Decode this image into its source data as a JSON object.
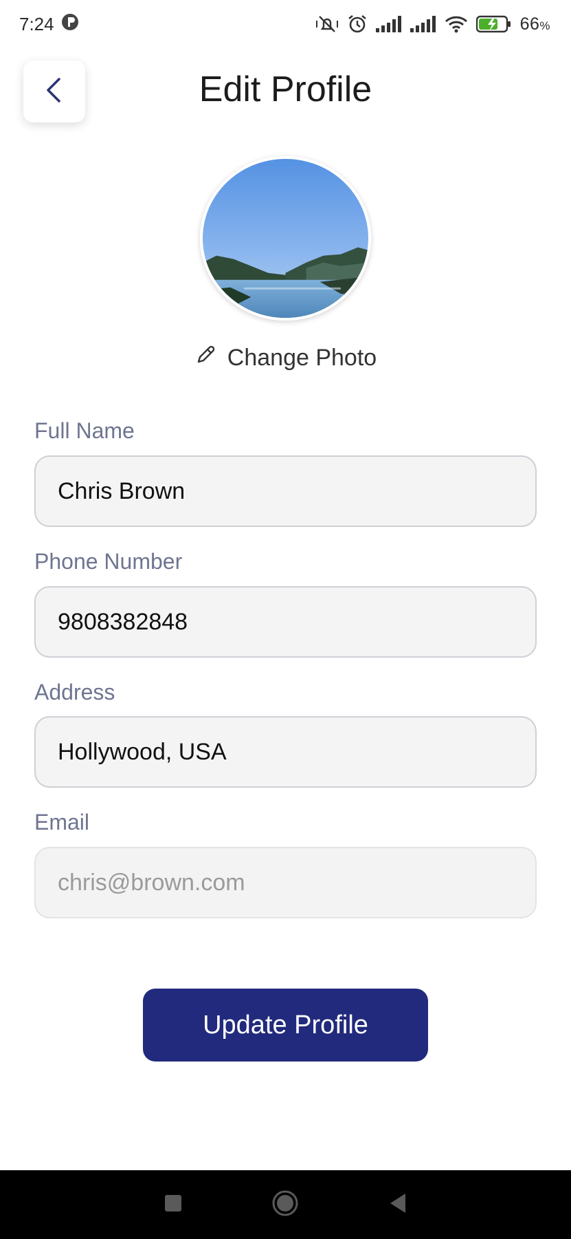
{
  "status_bar": {
    "time": "7:24",
    "battery_percent": "66",
    "battery_unit": "%"
  },
  "header": {
    "title": "Edit Profile"
  },
  "profile": {
    "change_photo_label": "Change Photo"
  },
  "form": {
    "full_name": {
      "label": "Full Name",
      "value": "Chris Brown"
    },
    "phone": {
      "label": "Phone Number",
      "value": "9808382848"
    },
    "address": {
      "label": "Address",
      "value": "Hollywood, USA"
    },
    "email": {
      "label": "Email",
      "value": "chris@brown.com"
    }
  },
  "actions": {
    "update_label": "Update Profile"
  },
  "colors": {
    "primary": "#212a7c",
    "label": "#6f7590",
    "field_bg": "#f4f4f4"
  },
  "icons": {
    "back": "chevron-left-icon",
    "edit": "pencil-icon",
    "nav_recents": "square-icon",
    "nav_home": "circle-icon",
    "nav_back": "triangle-back-icon"
  }
}
